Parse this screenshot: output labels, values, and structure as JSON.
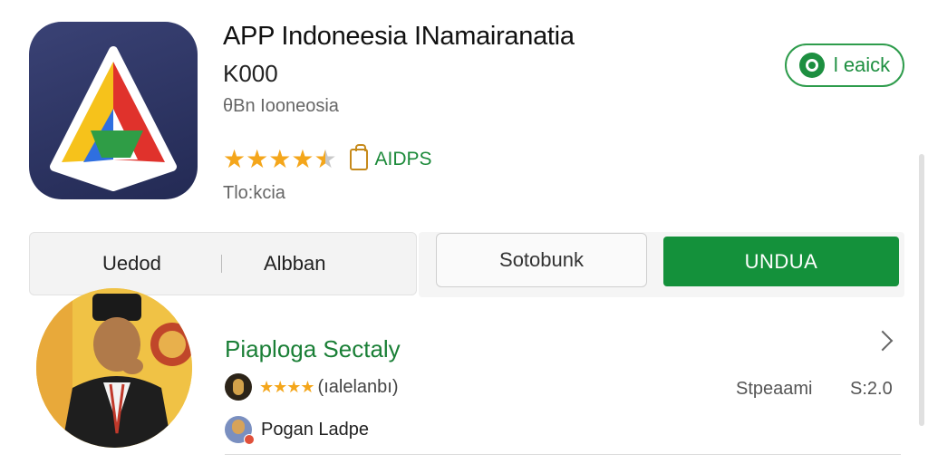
{
  "app": {
    "title": "APP Indoneesia INamairanatia",
    "price": "K000",
    "publisher": "θBn Iooneosia",
    "rating_stars": 4.5,
    "badge_label": "AIDPS",
    "category": "Tlo:kcia",
    "icon_name": "app-logo-icon"
  },
  "header_action": {
    "label": "l eaick",
    "icon": "whatsapp-icon",
    "color": "#1d8f40"
  },
  "tabs": [
    {
      "label": "Uedod"
    },
    {
      "label": "Albban"
    }
  ],
  "buttons": {
    "secondary_label": "Sotobunk",
    "primary_label": "UNDUA",
    "primary_color": "#14913b"
  },
  "review": {
    "title": "Piaploga Sectaly",
    "stars": 4,
    "meta": "(ıalelanbı)",
    "stat_label": "Stpeaami",
    "stat_value": "S:2.0",
    "author": "Pogan Ladpe"
  }
}
